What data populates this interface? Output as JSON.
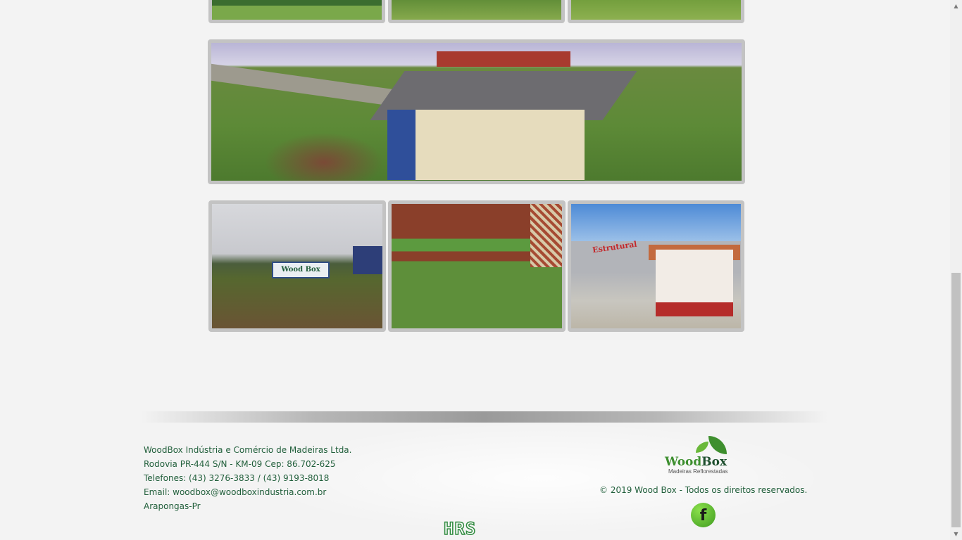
{
  "gallery": {
    "top_row": [
      "photo-1",
      "photo-2",
      "photo-3"
    ],
    "panorama": "factory-aerial-panorama",
    "bottom_row": [
      "wood-box-sign-photo",
      "garden-aerial-photo",
      "estrutural-building-photo"
    ],
    "bottom_photo_texts": {
      "sign": "Wood Box",
      "estrutural": "Estrutural"
    }
  },
  "footer": {
    "address_lines": [
      "WoodBox Indústria e Comércio de Madeiras Ltda.",
      "Rodovia PR-444 S/N - KM-09 Cep: 86.702-625",
      "Telefones: (43) 3276-3833 / (43) 9193-8018",
      "Email: woodbox@woodboxindustria.com.br",
      "Arapongas-Pr"
    ],
    "brand": {
      "name_part1": "Wood",
      "name_part2": "Box",
      "tagline": "Madeiras Reflorestadas"
    },
    "copyright": "© 2019 Wood Box - Todos os direitos reservados.",
    "facebook_icon": "f",
    "credit_logo": "HRS"
  },
  "colors": {
    "background": "#f3f3f3",
    "text_green": "#215f3b",
    "brand_green": "#3d8f2f",
    "thumb_border": "#c3c3c3"
  },
  "icons": [
    "facebook-icon",
    "leaf-icon"
  ]
}
